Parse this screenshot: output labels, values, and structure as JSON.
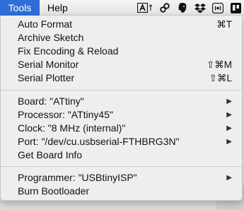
{
  "menubar": {
    "active_menu": "Tools",
    "other_menu": "Help"
  },
  "status_icons": [
    "adobe-icon",
    "link-icon",
    "evernote-icon",
    "dropbox-icon",
    "radio-icon",
    "trello-icon"
  ],
  "menu": {
    "group1": [
      {
        "label": "Auto Format",
        "shortcut": "⌘T"
      },
      {
        "label": "Archive Sketch",
        "shortcut": ""
      },
      {
        "label": "Fix Encoding & Reload",
        "shortcut": ""
      },
      {
        "label": "Serial Monitor",
        "shortcut": "⇧⌘M"
      },
      {
        "label": "Serial Plotter",
        "shortcut": "⇧⌘L"
      }
    ],
    "group2": [
      {
        "label": "Board: \"ATtiny\"",
        "submenu": true
      },
      {
        "label": "Processor: \"ATtiny45\"",
        "submenu": true
      },
      {
        "label": "Clock: \"8 MHz (internal)\"",
        "submenu": true
      },
      {
        "label": "Port: \"/dev/cu.usbserial-FTHBRG3N\"",
        "submenu": true
      },
      {
        "label": "Get Board Info",
        "submenu": false
      }
    ],
    "group3": [
      {
        "label": "Programmer: \"USBtinyISP\"",
        "submenu": true
      },
      {
        "label": "Burn Bootloader",
        "submenu": false
      }
    ],
    "arrow_glyph": "▶"
  }
}
